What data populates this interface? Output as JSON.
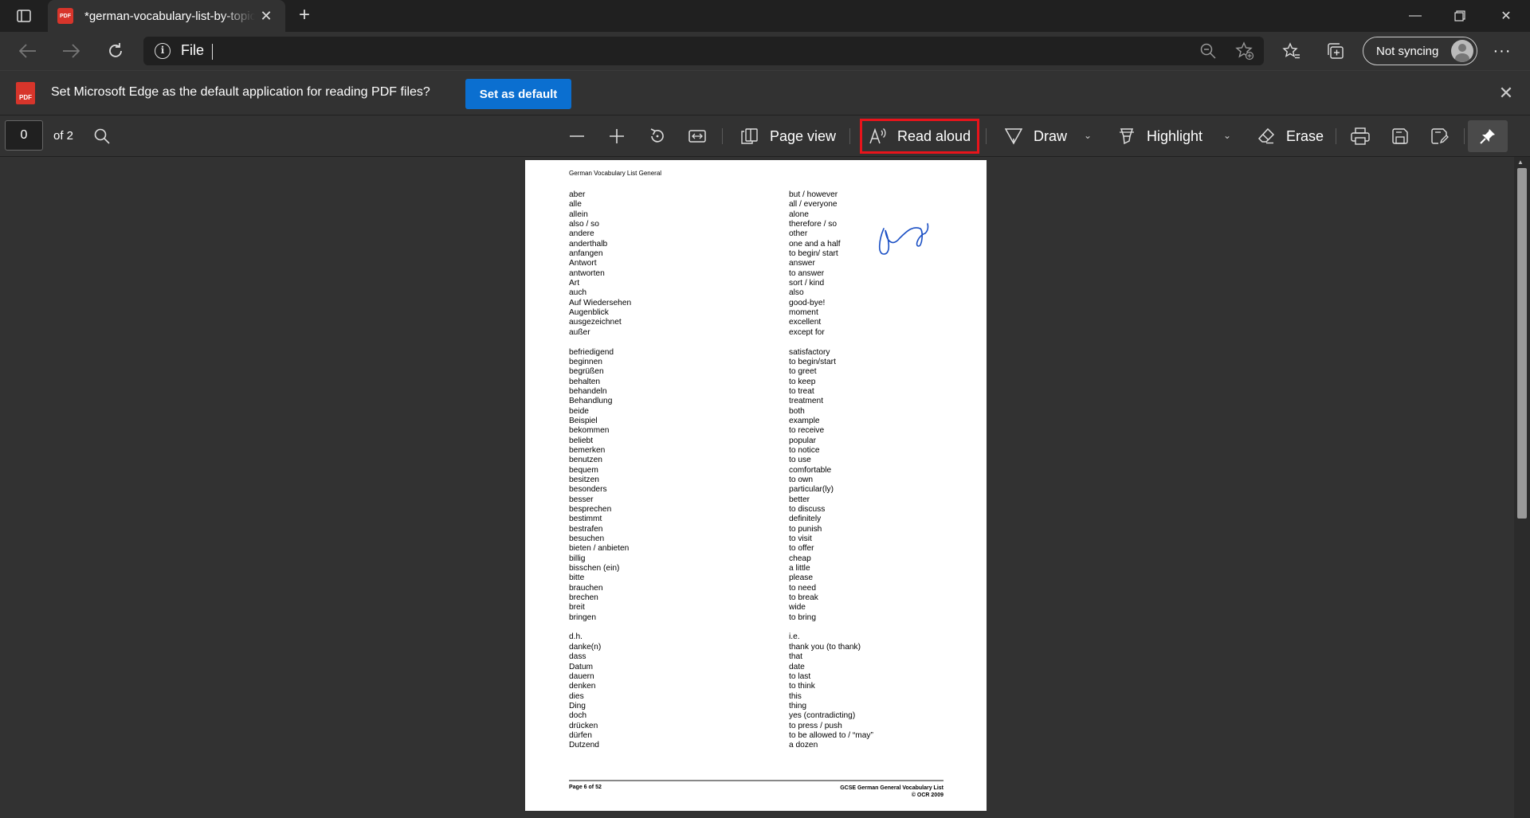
{
  "browser": {
    "tab_title": "*german-vocabulary-list-by-topic",
    "pdf_badge": "PDF",
    "address_text": "File",
    "sync_label": "Not syncing"
  },
  "infobar": {
    "message": "Set Microsoft Edge as the default application for reading PDF files?",
    "button_label": "Set as default",
    "pdf_badge": "PDF"
  },
  "pdf_toolbar": {
    "page_value": "0",
    "page_total": "of 2",
    "page_view_label": "Page view",
    "read_aloud_label": "Read aloud",
    "draw_label": "Draw",
    "highlight_label": "Highlight",
    "erase_label": "Erase"
  },
  "document": {
    "header": "German Vocabulary List General",
    "german": [
      "aber",
      "alle",
      "allein",
      "also / so",
      "andere",
      "anderthalb",
      "anfangen",
      "Antwort",
      "antworten",
      "Art",
      "auch",
      "Auf Wiedersehen",
      "Augenblick",
      "ausgezeichnet",
      "außer",
      "",
      "befriedigend",
      "beginnen",
      "begrüßen",
      "behalten",
      "behandeln",
      "Behandlung",
      "beide",
      "Beispiel",
      "bekommen",
      "beliebt",
      "bemerken",
      "benutzen",
      "bequem",
      "besitzen",
      "besonders",
      "besser",
      "besprechen",
      "bestimmt",
      "bestrafen",
      "besuchen",
      "bieten / anbieten",
      "billig",
      "bisschen (ein)",
      "bitte",
      "brauchen",
      "brechen",
      "breit",
      "bringen",
      "",
      "d.h.",
      "danke(n)",
      "dass",
      "Datum",
      "dauern",
      "denken",
      "dies",
      "Ding",
      "doch",
      "drücken",
      "dürfen",
      "Dutzend"
    ],
    "english": [
      "but / however",
      "all / everyone",
      "alone",
      "therefore / so",
      "other",
      "one and a half",
      "to begin/ start",
      "answer",
      "to answer",
      "sort / kind",
      "also",
      "good-bye!",
      "moment",
      "excellent",
      "except for",
      "",
      "satisfactory",
      "to begin/start",
      "to greet",
      "to keep",
      "to treat",
      "treatment",
      "both",
      "example",
      "to receive",
      "popular",
      "to notice",
      "to use",
      "comfortable",
      "to own",
      "particular(ly)",
      "better",
      "to discuss",
      "definitely",
      "to punish",
      "to visit",
      "to offer",
      "cheap",
      "a little",
      "please",
      "to need",
      "to break",
      "wide",
      "to bring",
      "",
      "i.e.",
      "thank you (to thank)",
      "that",
      "date",
      "to last",
      "to think",
      "this",
      "thing",
      "yes (contradicting)",
      "to press / push",
      "to be allowed to / “may”",
      "a dozen"
    ],
    "footer_left": "Page 6 of 52",
    "footer_right_1": "GCSE German General Vocabulary List",
    "footer_right_2": "© OCR 2009"
  }
}
